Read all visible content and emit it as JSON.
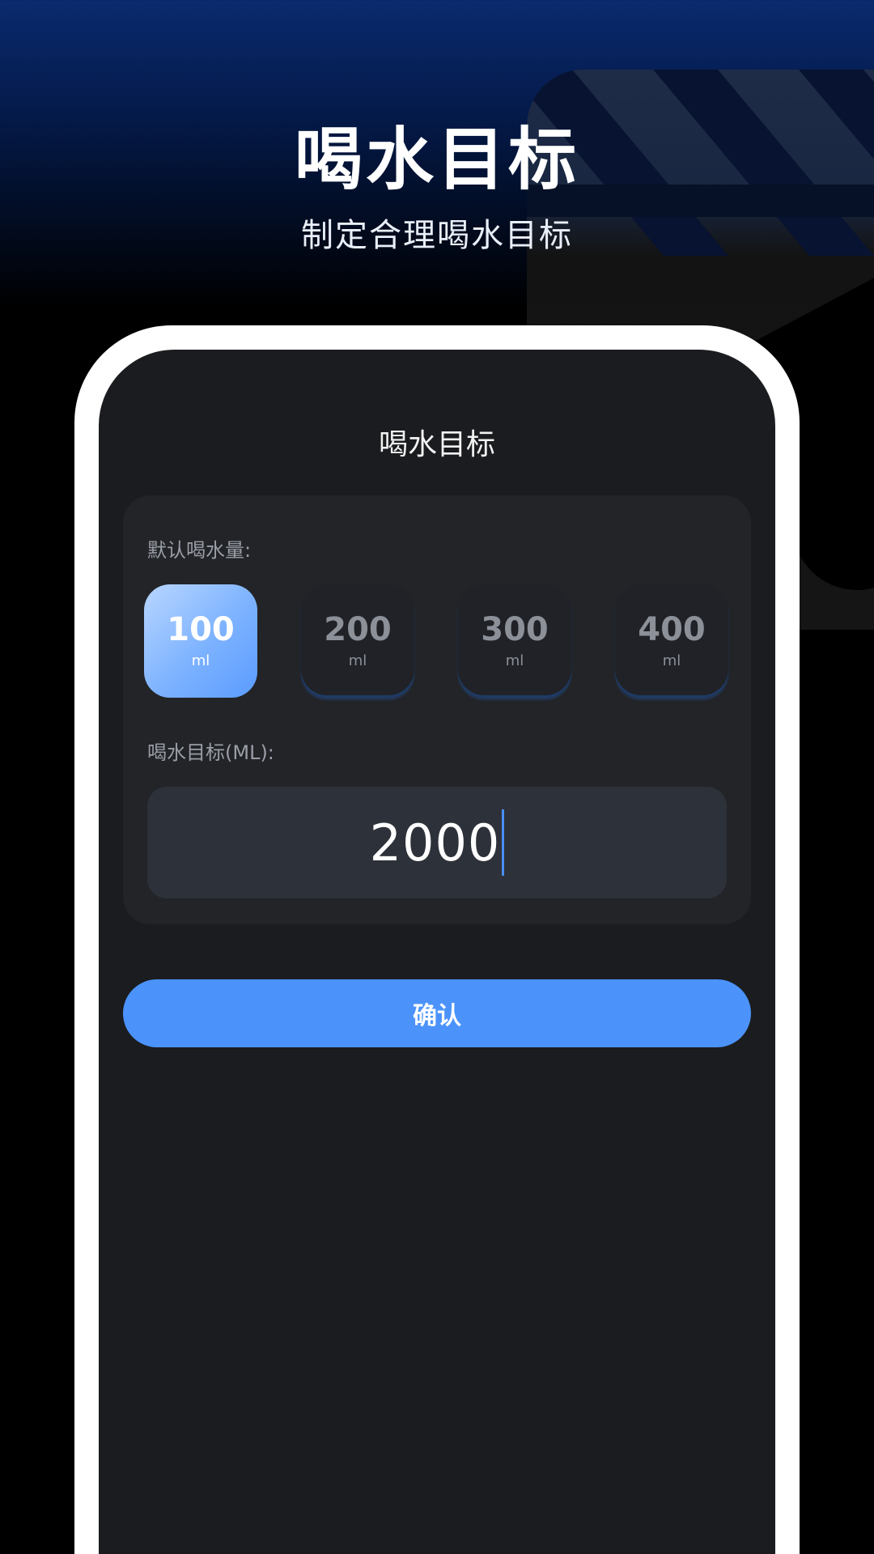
{
  "hero": {
    "title": "喝水目标",
    "subtitle": "制定合理喝水目标"
  },
  "screen": {
    "title": "喝水目标",
    "default_label": "默认喝水量:",
    "amount_options": [
      {
        "value": "100",
        "unit": "ml",
        "selected": true
      },
      {
        "value": "200",
        "unit": "ml",
        "selected": false
      },
      {
        "value": "300",
        "unit": "ml",
        "selected": false
      },
      {
        "value": "400",
        "unit": "ml",
        "selected": false
      }
    ],
    "goal_label": "喝水目标(ML):",
    "goal_value": "2000",
    "confirm_label": "确认"
  },
  "colors": {
    "accent": "#4b93fb",
    "selected_chip": "#7cb2ff",
    "screen_bg": "#1b1c1f",
    "panel_bg": "#222428"
  },
  "icons": {}
}
